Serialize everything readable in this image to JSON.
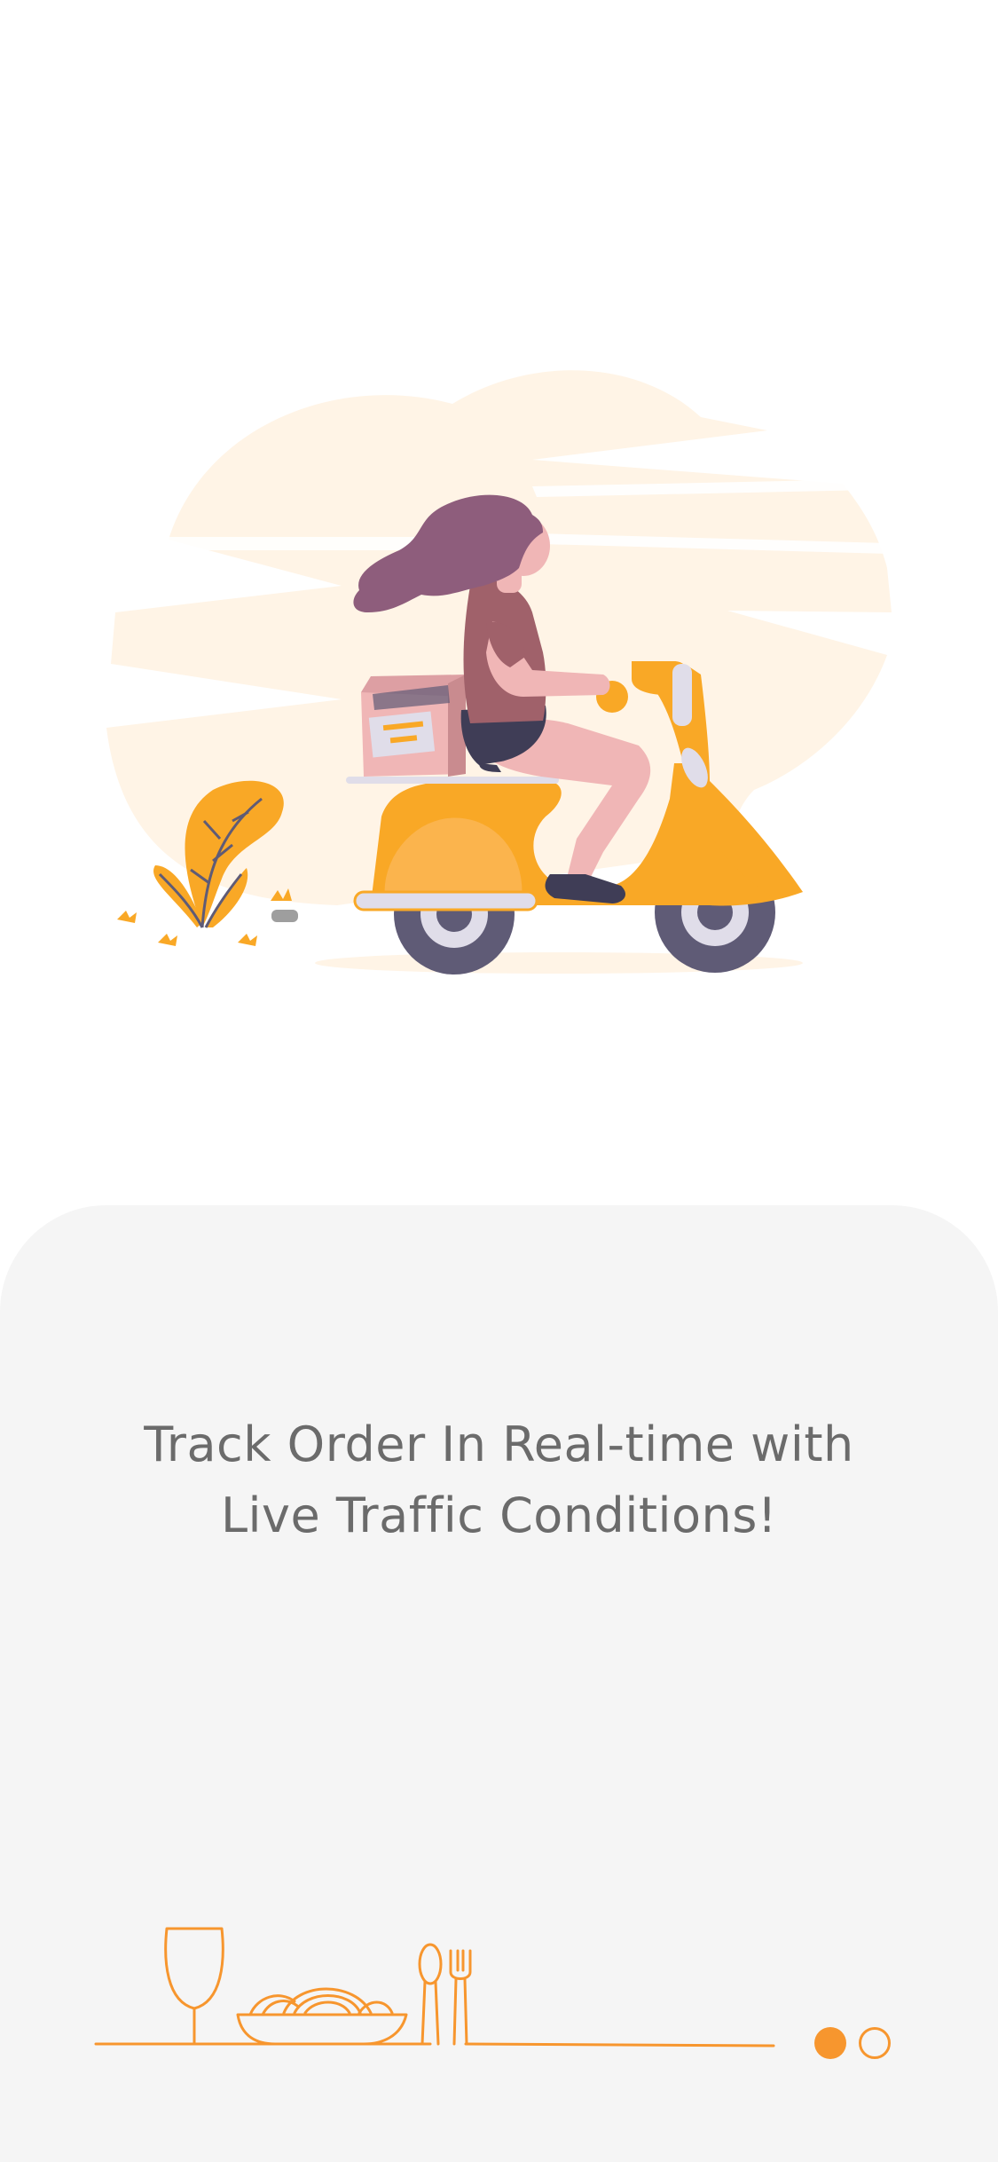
{
  "onboarding": {
    "headline_line1": "Track Order In Real-time with",
    "headline_line2": "Live Traffic Conditions!",
    "current_page": 1,
    "total_pages": 2,
    "illustration": "delivery-scooter-illustration",
    "decoration": "food-line-art"
  },
  "colors": {
    "accent": "#f7962e",
    "scooter": "#f9a826",
    "hair": "#8e5d7c",
    "shirt": "#a0616a",
    "skin": "#f0b6b6",
    "wheel": "#5f5b76",
    "cloud": "#fff4e6",
    "sheet": "#f5f5f5",
    "text": "#6b6b6b"
  }
}
